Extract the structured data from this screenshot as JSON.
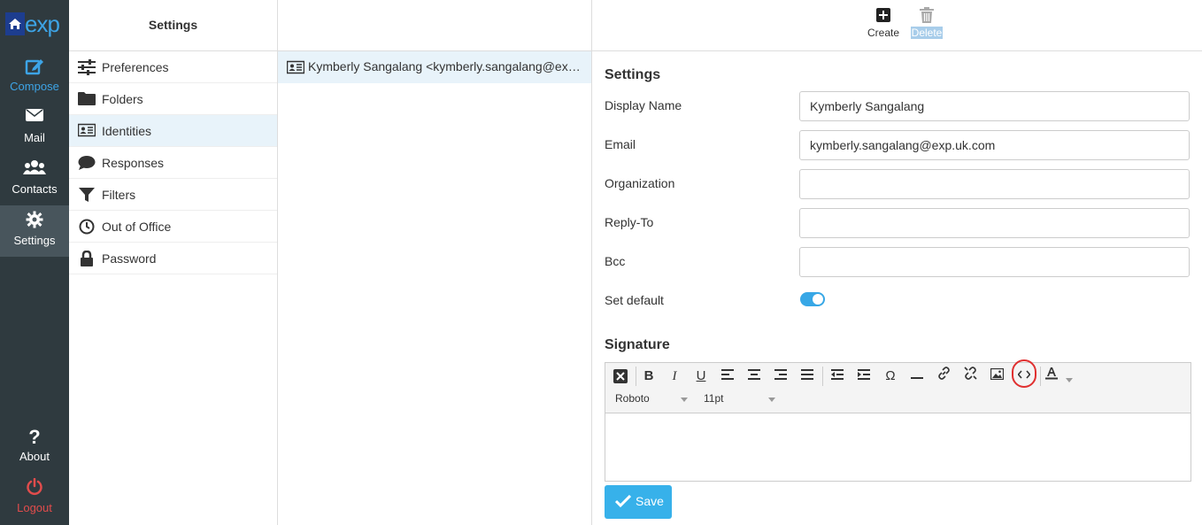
{
  "logo_text": "exp",
  "nav": {
    "compose": "Compose",
    "mail": "Mail",
    "contacts": "Contacts",
    "settings": "Settings",
    "about": "About",
    "logout": "Logout"
  },
  "settings_header": "Settings",
  "settings_items": [
    {
      "label": "Preferences",
      "icon": "sliders-icon"
    },
    {
      "label": "Folders",
      "icon": "folder-icon"
    },
    {
      "label": "Identities",
      "icon": "id-card-icon"
    },
    {
      "label": "Responses",
      "icon": "comment-icon"
    },
    {
      "label": "Filters",
      "icon": "filter-icon"
    },
    {
      "label": "Out of Office",
      "icon": "clock-icon"
    },
    {
      "label": "Password",
      "icon": "lock-icon"
    }
  ],
  "identity_list": [
    "Kymberly Sangalang <kymberly.sangalang@exp.uk.com>"
  ],
  "toolbar": {
    "create": "Create",
    "delete": "Delete"
  },
  "form": {
    "section_title": "Settings",
    "display_name_label": "Display Name",
    "display_name_value": "Kymberly Sangalang",
    "email_label": "Email",
    "email_value": "kymberly.sangalang@exp.uk.com",
    "organization_label": "Organization",
    "organization_value": "",
    "replyto_label": "Reply-To",
    "replyto_value": "",
    "bcc_label": "Bcc",
    "bcc_value": "",
    "set_default_label": "Set default",
    "set_default_on": true,
    "signature_title": "Signature",
    "font_family": "Roboto",
    "font_size": "11pt",
    "save_label": "Save"
  },
  "colors": {
    "accent": "#37a7e6",
    "nav_bg": "#2f3a3f",
    "logout": "#e14c4c",
    "highlight_circle": "#e03030"
  }
}
